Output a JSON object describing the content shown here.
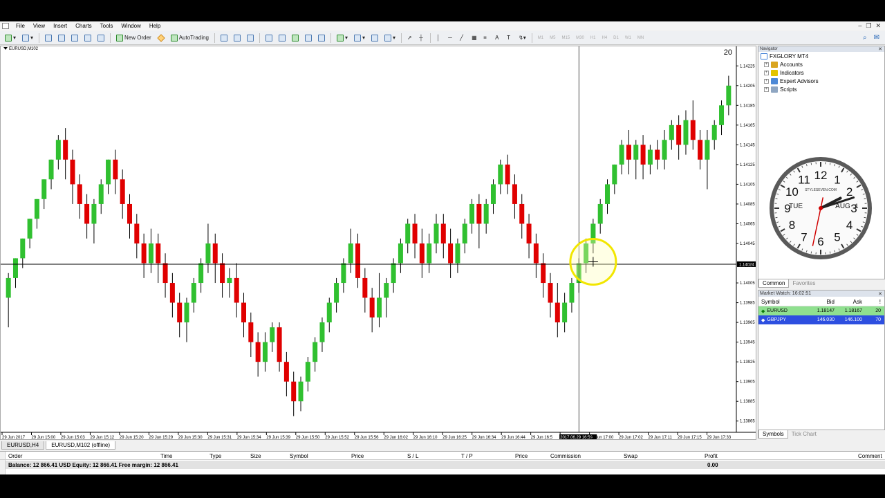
{
  "menu": {
    "items": [
      "File",
      "View",
      "Insert",
      "Charts",
      "Tools",
      "Window",
      "Help"
    ]
  },
  "toolbar": {
    "new_order_label": "New Order",
    "autotrading_label": "AutoTrading",
    "timeframes": [
      "M1",
      "M5",
      "M15",
      "M30",
      "H1",
      "H4",
      "D1",
      "W1",
      "MN"
    ]
  },
  "chart": {
    "title": "EURUSD,M102",
    "bar_timer": "20",
    "price_ticks": [
      "1.14225",
      "1.14205",
      "1.14185",
      "1.14165",
      "1.14145",
      "1.14125",
      "1.14105",
      "1.14085",
      "1.14065",
      "1.14045",
      "1.14024",
      "1.14005",
      "1.13985",
      "1.13965",
      "1.13945",
      "1.13925",
      "1.13905",
      "1.13885",
      "1.13865"
    ],
    "current_price": "1.14024",
    "time_ticks": [
      "29 Jun 2017",
      "29 Jun 15:00",
      "29 Jun 15:03",
      "29 Jun 15:12",
      "29 Jun 15:20",
      "29 Jun 15:29",
      "29 Jun 15:30",
      "29 Jun 15:31",
      "29 Jun 15:34",
      "29 Jun 15:39",
      "29 Jun 15:50",
      "29 Jun 15:52",
      "29 Jun 15:56",
      "29 Jun 16:02",
      "29 Jun 16:10",
      "29 Jun 16:25",
      "29 Jun 16:34",
      "29 Jun 16:44",
      "29 Jun 16:5",
      "2017.06.29 16:59",
      "29 Jun 17:00",
      "29 Jun 17:02",
      "29 Jun 17:11",
      "29 Jun 17:15",
      "29 Jun 17:33"
    ],
    "crosshair_time": "2017.06.29 16:59",
    "bull_color": "#30c030",
    "bear_color": "#e00000"
  },
  "chart_data": {
    "type": "candlestick",
    "title": "EURUSD,M102",
    "ylim": [
      1.13855,
      1.14235
    ],
    "candles": [
      {
        "o": 1.1399,
        "h": 1.14015,
        "l": 1.1396,
        "c": 1.1401
      },
      {
        "o": 1.1401,
        "h": 1.1403,
        "l": 1.14,
        "c": 1.1403
      },
      {
        "o": 1.1403,
        "h": 1.1405,
        "l": 1.1402,
        "c": 1.1405
      },
      {
        "o": 1.1405,
        "h": 1.1407,
        "l": 1.1404,
        "c": 1.1407
      },
      {
        "o": 1.1407,
        "h": 1.1409,
        "l": 1.1406,
        "c": 1.1409
      },
      {
        "o": 1.1409,
        "h": 1.1411,
        "l": 1.1408,
        "c": 1.1411
      },
      {
        "o": 1.1411,
        "h": 1.1413,
        "l": 1.141,
        "c": 1.1413
      },
      {
        "o": 1.1413,
        "h": 1.14155,
        "l": 1.1412,
        "c": 1.1415
      },
      {
        "o": 1.1415,
        "h": 1.14162,
        "l": 1.1411,
        "c": 1.1413
      },
      {
        "o": 1.1413,
        "h": 1.1414,
        "l": 1.14085,
        "c": 1.14105
      },
      {
        "o": 1.14105,
        "h": 1.14115,
        "l": 1.1407,
        "c": 1.14085
      },
      {
        "o": 1.14085,
        "h": 1.14095,
        "l": 1.1405,
        "c": 1.14065
      },
      {
        "o": 1.14065,
        "h": 1.1409,
        "l": 1.14045,
        "c": 1.14085
      },
      {
        "o": 1.14085,
        "h": 1.1411,
        "l": 1.14075,
        "c": 1.14105
      },
      {
        "o": 1.14105,
        "h": 1.1413,
        "l": 1.14095,
        "c": 1.1413
      },
      {
        "o": 1.1413,
        "h": 1.1414,
        "l": 1.14095,
        "c": 1.1411
      },
      {
        "o": 1.1411,
        "h": 1.1412,
        "l": 1.1407,
        "c": 1.14085
      },
      {
        "o": 1.14085,
        "h": 1.14095,
        "l": 1.1405,
        "c": 1.14065
      },
      {
        "o": 1.14065,
        "h": 1.14075,
        "l": 1.1403,
        "c": 1.14045
      },
      {
        "o": 1.14045,
        "h": 1.14055,
        "l": 1.1401,
        "c": 1.14025
      },
      {
        "o": 1.14025,
        "h": 1.1406,
        "l": 1.14015,
        "c": 1.14045
      },
      {
        "o": 1.14045,
        "h": 1.14055,
        "l": 1.14005,
        "c": 1.14025
      },
      {
        "o": 1.14025,
        "h": 1.14035,
        "l": 1.1399,
        "c": 1.14005
      },
      {
        "o": 1.14005,
        "h": 1.14015,
        "l": 1.1397,
        "c": 1.13985
      },
      {
        "o": 1.13985,
        "h": 1.13995,
        "l": 1.1395,
        "c": 1.13965
      },
      {
        "o": 1.13965,
        "h": 1.1399,
        "l": 1.13945,
        "c": 1.13985
      },
      {
        "o": 1.13985,
        "h": 1.1401,
        "l": 1.13975,
        "c": 1.14005
      },
      {
        "o": 1.14005,
        "h": 1.1403,
        "l": 1.13995,
        "c": 1.14025
      },
      {
        "o": 1.14025,
        "h": 1.14065,
        "l": 1.14015,
        "c": 1.14045
      },
      {
        "o": 1.14045,
        "h": 1.14055,
        "l": 1.14005,
        "c": 1.14025
      },
      {
        "o": 1.14025,
        "h": 1.14035,
        "l": 1.1399,
        "c": 1.14005
      },
      {
        "o": 1.14005,
        "h": 1.1402,
        "l": 1.1399,
        "c": 1.1401
      },
      {
        "o": 1.1401,
        "h": 1.14025,
        "l": 1.1397,
        "c": 1.13985
      },
      {
        "o": 1.13985,
        "h": 1.13995,
        "l": 1.1395,
        "c": 1.13965
      },
      {
        "o": 1.13965,
        "h": 1.13975,
        "l": 1.1393,
        "c": 1.13945
      },
      {
        "o": 1.13945,
        "h": 1.13955,
        "l": 1.1391,
        "c": 1.13925
      },
      {
        "o": 1.13925,
        "h": 1.13955,
        "l": 1.13915,
        "c": 1.13945
      },
      {
        "o": 1.13945,
        "h": 1.13965,
        "l": 1.13935,
        "c": 1.1396
      },
      {
        "o": 1.1396,
        "h": 1.13965,
        "l": 1.13915,
        "c": 1.13925
      },
      {
        "o": 1.13925,
        "h": 1.13935,
        "l": 1.1389,
        "c": 1.13905
      },
      {
        "o": 1.13905,
        "h": 1.13915,
        "l": 1.1387,
        "c": 1.13885
      },
      {
        "o": 1.13885,
        "h": 1.1391,
        "l": 1.13875,
        "c": 1.13905
      },
      {
        "o": 1.13905,
        "h": 1.1393,
        "l": 1.13895,
        "c": 1.13925
      },
      {
        "o": 1.13925,
        "h": 1.1395,
        "l": 1.13915,
        "c": 1.13945
      },
      {
        "o": 1.13945,
        "h": 1.1397,
        "l": 1.13935,
        "c": 1.13965
      },
      {
        "o": 1.13965,
        "h": 1.1399,
        "l": 1.13955,
        "c": 1.13985
      },
      {
        "o": 1.13985,
        "h": 1.1401,
        "l": 1.13975,
        "c": 1.14005
      },
      {
        "o": 1.14005,
        "h": 1.1403,
        "l": 1.13995,
        "c": 1.14025
      },
      {
        "o": 1.14025,
        "h": 1.1406,
        "l": 1.14015,
        "c": 1.14045
      },
      {
        "o": 1.14045,
        "h": 1.14055,
        "l": 1.14,
        "c": 1.1401
      },
      {
        "o": 1.1401,
        "h": 1.1402,
        "l": 1.13975,
        "c": 1.1399
      },
      {
        "o": 1.1399,
        "h": 1.14,
        "l": 1.13955,
        "c": 1.1397
      },
      {
        "o": 1.1397,
        "h": 1.14015,
        "l": 1.1396,
        "c": 1.1399
      },
      {
        "o": 1.1399,
        "h": 1.1401,
        "l": 1.1397,
        "c": 1.14005
      },
      {
        "o": 1.14005,
        "h": 1.1403,
        "l": 1.13995,
        "c": 1.14025
      },
      {
        "o": 1.14025,
        "h": 1.1405,
        "l": 1.14015,
        "c": 1.14045
      },
      {
        "o": 1.14045,
        "h": 1.1407,
        "l": 1.14035,
        "c": 1.14065
      },
      {
        "o": 1.14065,
        "h": 1.14075,
        "l": 1.1403,
        "c": 1.14045
      },
      {
        "o": 1.14045,
        "h": 1.1406,
        "l": 1.1401,
        "c": 1.14025
      },
      {
        "o": 1.14025,
        "h": 1.14055,
        "l": 1.14015,
        "c": 1.14045
      },
      {
        "o": 1.14045,
        "h": 1.14075,
        "l": 1.14035,
        "c": 1.14065
      },
      {
        "o": 1.14065,
        "h": 1.14075,
        "l": 1.1403,
        "c": 1.14045
      },
      {
        "o": 1.14045,
        "h": 1.1406,
        "l": 1.1401,
        "c": 1.14025
      },
      {
        "o": 1.14025,
        "h": 1.1405,
        "l": 1.14015,
        "c": 1.14045
      },
      {
        "o": 1.14045,
        "h": 1.1407,
        "l": 1.14035,
        "c": 1.14065
      },
      {
        "o": 1.14065,
        "h": 1.1409,
        "l": 1.14055,
        "c": 1.14085
      },
      {
        "o": 1.14085,
        "h": 1.14095,
        "l": 1.1404,
        "c": 1.14065
      },
      {
        "o": 1.14065,
        "h": 1.1409,
        "l": 1.14055,
        "c": 1.14085
      },
      {
        "o": 1.14085,
        "h": 1.1411,
        "l": 1.14075,
        "c": 1.14105
      },
      {
        "o": 1.14105,
        "h": 1.1413,
        "l": 1.14095,
        "c": 1.14125
      },
      {
        "o": 1.14125,
        "h": 1.14135,
        "l": 1.14095,
        "c": 1.14105
      },
      {
        "o": 1.14105,
        "h": 1.14115,
        "l": 1.1407,
        "c": 1.14085
      },
      {
        "o": 1.14085,
        "h": 1.14095,
        "l": 1.1405,
        "c": 1.14065
      },
      {
        "o": 1.14065,
        "h": 1.14075,
        "l": 1.1403,
        "c": 1.14045
      },
      {
        "o": 1.14045,
        "h": 1.14055,
        "l": 1.1401,
        "c": 1.14025
      },
      {
        "o": 1.14025,
        "h": 1.14035,
        "l": 1.1399,
        "c": 1.14005
      },
      {
        "o": 1.14005,
        "h": 1.14015,
        "l": 1.1397,
        "c": 1.13985
      },
      {
        "o": 1.13985,
        "h": 1.14005,
        "l": 1.1395,
        "c": 1.13965
      },
      {
        "o": 1.13965,
        "h": 1.13995,
        "l": 1.13955,
        "c": 1.13985
      },
      {
        "o": 1.13985,
        "h": 1.1401,
        "l": 1.13975,
        "c": 1.14005
      },
      {
        "o": 1.14005,
        "h": 1.1403,
        "l": 1.13995,
        "c": 1.14025
      },
      {
        "o": 1.14025,
        "h": 1.1405,
        "l": 1.14015,
        "c": 1.14045
      },
      {
        "o": 1.14045,
        "h": 1.1407,
        "l": 1.14035,
        "c": 1.14065
      },
      {
        "o": 1.14065,
        "h": 1.1409,
        "l": 1.14055,
        "c": 1.14085
      },
      {
        "o": 1.14085,
        "h": 1.1411,
        "l": 1.14075,
        "c": 1.14105
      },
      {
        "o": 1.14105,
        "h": 1.14125,
        "l": 1.14095,
        "c": 1.14125
      },
      {
        "o": 1.14125,
        "h": 1.1415,
        "l": 1.14115,
        "c": 1.14145
      },
      {
        "o": 1.14145,
        "h": 1.1416,
        "l": 1.14115,
        "c": 1.1413
      },
      {
        "o": 1.1413,
        "h": 1.1415,
        "l": 1.1411,
        "c": 1.14145
      },
      {
        "o": 1.14145,
        "h": 1.14155,
        "l": 1.1411,
        "c": 1.14125
      },
      {
        "o": 1.14125,
        "h": 1.14145,
        "l": 1.14115,
        "c": 1.1414
      },
      {
        "o": 1.1414,
        "h": 1.1415,
        "l": 1.1412,
        "c": 1.1413
      },
      {
        "o": 1.1413,
        "h": 1.1416,
        "l": 1.1412,
        "c": 1.1415
      },
      {
        "o": 1.1415,
        "h": 1.1417,
        "l": 1.1414,
        "c": 1.14165
      },
      {
        "o": 1.14165,
        "h": 1.14175,
        "l": 1.1413,
        "c": 1.14145
      },
      {
        "o": 1.14145,
        "h": 1.1418,
        "l": 1.14135,
        "c": 1.1417
      },
      {
        "o": 1.1417,
        "h": 1.1419,
        "l": 1.1414,
        "c": 1.1415
      },
      {
        "o": 1.1415,
        "h": 1.1416,
        "l": 1.1412,
        "c": 1.1413
      },
      {
        "o": 1.1413,
        "h": 1.1416,
        "l": 1.141,
        "c": 1.1415
      },
      {
        "o": 1.1415,
        "h": 1.1417,
        "l": 1.1414,
        "c": 1.14165
      },
      {
        "o": 1.14165,
        "h": 1.1419,
        "l": 1.14155,
        "c": 1.14185
      },
      {
        "o": 1.14185,
        "h": 1.14215,
        "l": 1.14175,
        "c": 1.14205
      }
    ]
  },
  "navigator": {
    "header": "Navigator",
    "root": "FXGLORY MT4",
    "items": [
      {
        "label": "Accounts",
        "icon": "accounts-icon"
      },
      {
        "label": "Indicators",
        "icon": "indicators-icon"
      },
      {
        "label": "Expert Advisors",
        "icon": "expert-advisors-icon"
      },
      {
        "label": "Scripts",
        "icon": "scripts-icon"
      }
    ],
    "tabs": [
      "Common",
      "Favorites"
    ]
  },
  "clock": {
    "numbers": [
      "12",
      "1",
      "2",
      "3",
      "4",
      "5",
      "6",
      "7",
      "8",
      "9",
      "10",
      "11"
    ],
    "brand": "STYLESEVEN.COM",
    "day": "TUE",
    "month": "AUG",
    "date": "1",
    "hour_hand_hours": 2.1,
    "minute_hand_minutes": 12,
    "second_hand_seconds": 32
  },
  "market_watch": {
    "header": "Market Watch: 16:02:51",
    "columns": [
      "Symbol",
      "Bid",
      "Ask",
      "!"
    ],
    "rows": [
      {
        "symbol": "EURUSD",
        "bid": "1.18147",
        "ask": "1.18167",
        "spread": "20"
      },
      {
        "symbol": "GBPJPY",
        "bid": "146.030",
        "ask": "146.100",
        "spread": "70"
      }
    ],
    "tabs": [
      "Symbols",
      "Tick Chart"
    ]
  },
  "chart_tabs": [
    "EURUSD,H4",
    "EURUSD,M102 (offline)"
  ],
  "terminal": {
    "columns": [
      "Order",
      "Time",
      "Type",
      "Size",
      "Symbol",
      "Price",
      "S / L",
      "T / P",
      "Price",
      "Commission",
      "Swap",
      "Profit",
      "Comment"
    ],
    "balance_line": "Balance: 12 866.41 USD  Equity: 12 866.41  Free margin: 12 866.41",
    "profit": "0.00"
  }
}
